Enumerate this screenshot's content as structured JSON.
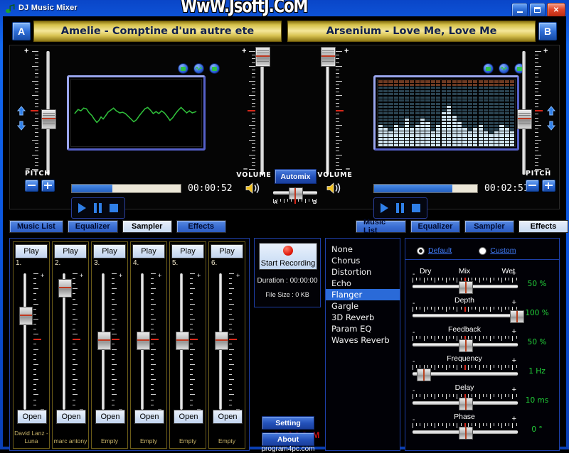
{
  "window": {
    "title": "DJ Music Mixer",
    "icon": "music-note-icon",
    "minimize_label": "Minimize",
    "maximize_label": "Maximize",
    "close_label": "Close",
    "watermark_top": "WwW.JsoftJ.CoM",
    "watermark_bottom": "JsoftJ.CoM"
  },
  "decks": {
    "a": {
      "badge": "A",
      "track": "Amelie - Comptine d'un autre ete",
      "time": "00:00:52",
      "progress": 37,
      "pitch_label": "PITCH",
      "volume_label": "VOLUME",
      "display_mode": "waveform",
      "transport": {
        "play": "Play",
        "pause": "Pause",
        "stop": "Stop"
      },
      "pitch_minus": "-",
      "pitch_plus": "+",
      "view_buttons": [
        "display-mode-1",
        "display-mode-2",
        "display-mode-3"
      ]
    },
    "b": {
      "badge": "B",
      "track": "Arsenium - Love Me, Love Me",
      "time": "00:02:51",
      "progress": 76,
      "pitch_label": "PITCH",
      "volume_label": "VOLUME",
      "display_mode": "spectrum",
      "transport": {
        "play": "Play",
        "pause": "Pause",
        "stop": "Stop"
      },
      "pitch_minus": "-",
      "pitch_plus": "+",
      "view_buttons": [
        "display-mode-1",
        "display-mode-2",
        "display-mode-3"
      ]
    }
  },
  "automix": {
    "label": "Automix",
    "crossfader_a": "A",
    "crossfader_b": "B",
    "crossfader_value": 50
  },
  "tabs_left": [
    {
      "label": "Music List",
      "active": false
    },
    {
      "label": "Equalizer",
      "active": false
    },
    {
      "label": "Sampler",
      "active": true
    },
    {
      "label": "Effects",
      "active": false
    }
  ],
  "tabs_right": [
    {
      "label": "Music List",
      "active": false
    },
    {
      "label": "Equalizer",
      "active": false
    },
    {
      "label": "Sampler",
      "active": false
    },
    {
      "label": "Effects",
      "active": true
    }
  ],
  "sampler": {
    "play_label": "Play",
    "open_label": "Open",
    "channels": [
      {
        "num": "1.",
        "name": "David Lanz - Luna",
        "level": 72
      },
      {
        "num": "2.",
        "name": "marc antony",
        "level": 95
      },
      {
        "num": "3.",
        "name": "Empty",
        "level": 51
      },
      {
        "num": "4.",
        "name": "Empty",
        "level": 51
      },
      {
        "num": "5.",
        "name": "Empty",
        "level": 51
      },
      {
        "num": "6.",
        "name": "Empty",
        "level": 51
      }
    ]
  },
  "recorder": {
    "button_label": "Start Recording",
    "duration_label": "Duration : 00:00:00",
    "filesize_label": "File Size : 0 KB"
  },
  "effects_list": {
    "items": [
      "None",
      "Chorus",
      "Distortion",
      "Echo",
      "Flanger",
      "Gargle",
      "3D Reverb",
      "Param EQ",
      "Waves Reverb"
    ],
    "selected": "Flanger"
  },
  "effects_panel": {
    "mode_default": "Default",
    "mode_custom": "Custom",
    "mode_selected": "Default",
    "dry_label": "Dry",
    "wet_label": "Wet",
    "minus": "-",
    "plus": "+",
    "params": [
      {
        "name": "Mix",
        "value": "50 %",
        "pos": 50
      },
      {
        "name": "Depth",
        "value": "100 %",
        "pos": 100
      },
      {
        "name": "Feedback",
        "value": "50 %",
        "pos": 50
      },
      {
        "name": "Frequency",
        "value": "1 Hz",
        "pos": 9
      },
      {
        "name": "Delay",
        "value": "10 ms",
        "pos": 50
      },
      {
        "name": "Phase",
        "value": "0 °",
        "pos": 50
      }
    ]
  },
  "footer": {
    "setting_label": "Setting",
    "about_label": "About",
    "site_label": "program4pc.com"
  },
  "colors": {
    "accent_blue": "#2a6ad8",
    "title_blue": "#1268f0",
    "track_gold": "#d8c352",
    "value_green": "#23d23a",
    "waveform_green": "#2fbe3a",
    "watermark_red": "#cc1111"
  }
}
